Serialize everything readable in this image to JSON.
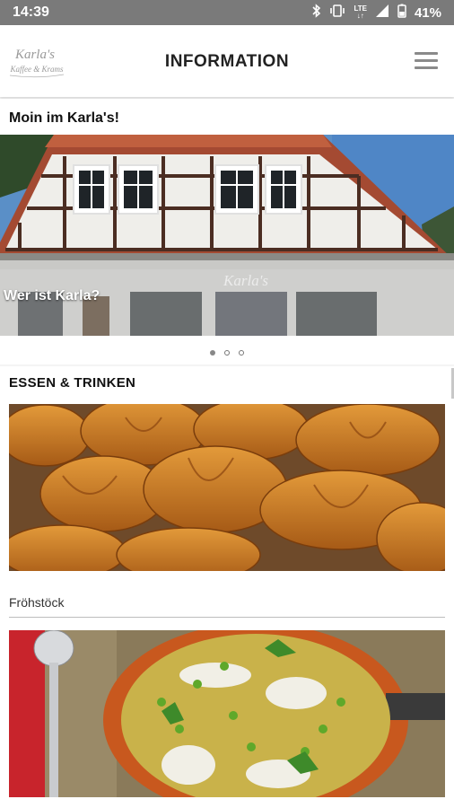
{
  "status_bar": {
    "time": "14:39",
    "network": "LTE",
    "battery": "41%",
    "icons": [
      "bluetooth-icon",
      "vibrate-icon",
      "lte-icon",
      "signal-icon",
      "battery-icon"
    ]
  },
  "app_bar": {
    "title": "INFORMATION",
    "logo": {
      "line1": "Karla's",
      "line2": "Kaffee & Krams"
    },
    "menu_icon": "hamburger-menu-icon"
  },
  "welcome": {
    "heading": "Moin im Karla's!",
    "carousel": {
      "caption": "Wer ist Karla?",
      "sign_text": "Karla's",
      "slide_count": 3,
      "active_index": 0
    }
  },
  "food_section": {
    "heading": "ESSEN & TRINKEN",
    "items": [
      {
        "label": "Fröhstöck"
      }
    ]
  },
  "colors": {
    "status_bar": "#7a7a7a",
    "app_bar": "#ffffff",
    "background": "#f4f4f4",
    "text": "#222222"
  }
}
